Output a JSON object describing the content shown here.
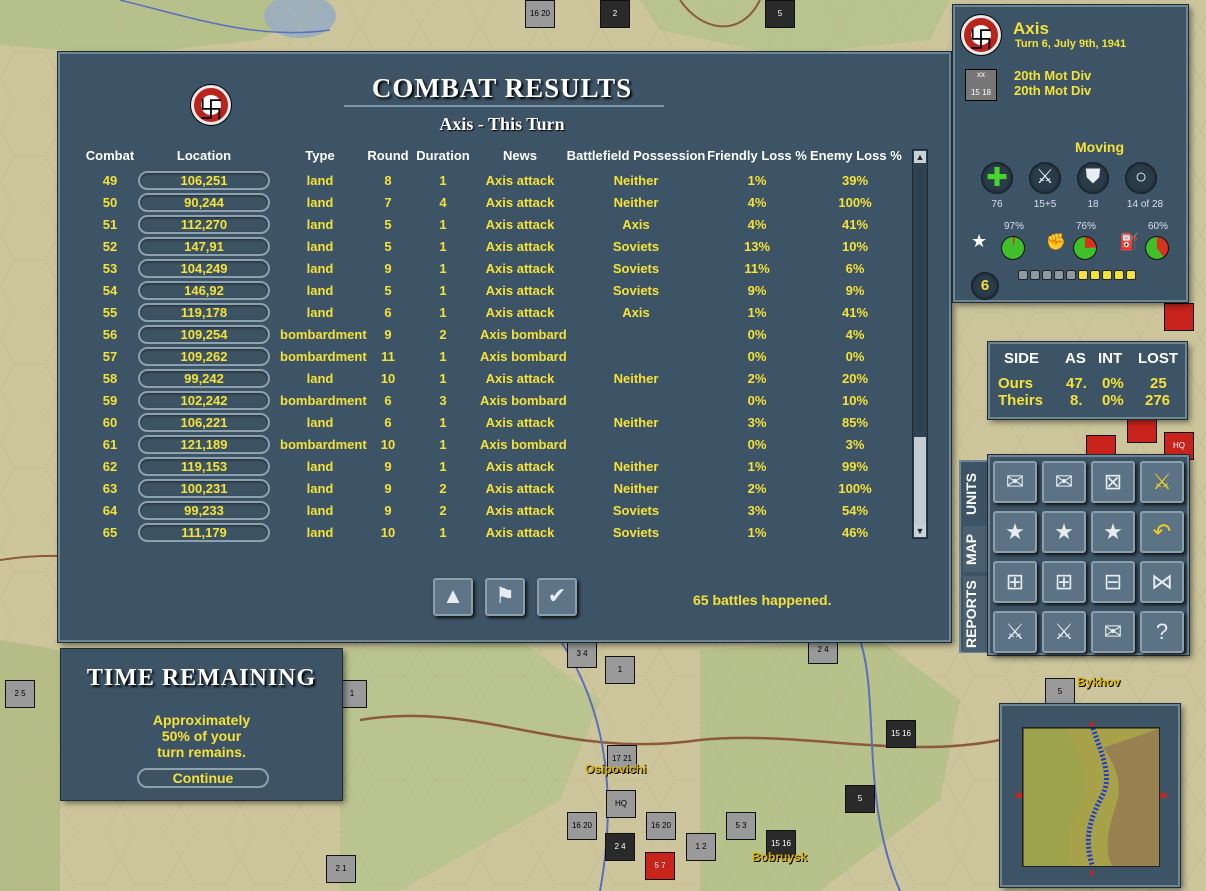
{
  "combat": {
    "title": "COMBAT RESULTS",
    "subtitle": "Axis - This Turn",
    "headers": {
      "combat": "Combat",
      "location": "Location",
      "type": "Type",
      "round": "Round",
      "duration": "Duration",
      "news": "News",
      "possession": "Battlefield Possession",
      "friendly": "Friendly Loss %",
      "enemy": "Enemy Loss %"
    },
    "rows": [
      {
        "combat": "49",
        "location": "106,251",
        "type": "land",
        "round": "8",
        "duration": "1",
        "news": "Axis attack",
        "possession": "Neither",
        "friendly": "1%",
        "enemy": "39%"
      },
      {
        "combat": "50",
        "location": "90,244",
        "type": "land",
        "round": "7",
        "duration": "4",
        "news": "Axis attack",
        "possession": "Neither",
        "friendly": "4%",
        "enemy": "100%"
      },
      {
        "combat": "51",
        "location": "112,270",
        "type": "land",
        "round": "5",
        "duration": "1",
        "news": "Axis attack",
        "possession": "Axis",
        "friendly": "4%",
        "enemy": "41%"
      },
      {
        "combat": "52",
        "location": "147,91",
        "type": "land",
        "round": "5",
        "duration": "1",
        "news": "Axis attack",
        "possession": "Soviets",
        "friendly": "13%",
        "enemy": "10%"
      },
      {
        "combat": "53",
        "location": "104,249",
        "type": "land",
        "round": "9",
        "duration": "1",
        "news": "Axis attack",
        "possession": "Soviets",
        "friendly": "11%",
        "enemy": "6%"
      },
      {
        "combat": "54",
        "location": "146,92",
        "type": "land",
        "round": "5",
        "duration": "1",
        "news": "Axis attack",
        "possession": "Soviets",
        "friendly": "9%",
        "enemy": "9%"
      },
      {
        "combat": "55",
        "location": "119,178",
        "type": "land",
        "round": "6",
        "duration": "1",
        "news": "Axis attack",
        "possession": "Axis",
        "friendly": "1%",
        "enemy": "41%"
      },
      {
        "combat": "56",
        "location": "109,254",
        "type": "bombardment",
        "round": "9",
        "duration": "2",
        "news": "Axis bombard",
        "possession": "",
        "friendly": "0%",
        "enemy": "4%"
      },
      {
        "combat": "57",
        "location": "109,262",
        "type": "bombardment",
        "round": "11",
        "duration": "1",
        "news": "Axis bombard",
        "possession": "",
        "friendly": "0%",
        "enemy": "0%"
      },
      {
        "combat": "58",
        "location": "99,242",
        "type": "land",
        "round": "10",
        "duration": "1",
        "news": "Axis attack",
        "possession": "Neither",
        "friendly": "2%",
        "enemy": "20%"
      },
      {
        "combat": "59",
        "location": "102,242",
        "type": "bombardment",
        "round": "6",
        "duration": "3",
        "news": "Axis bombard",
        "possession": "",
        "friendly": "0%",
        "enemy": "10%"
      },
      {
        "combat": "60",
        "location": "106,221",
        "type": "land",
        "round": "6",
        "duration": "1",
        "news": "Axis attack",
        "possession": "Neither",
        "friendly": "3%",
        "enemy": "85%"
      },
      {
        "combat": "61",
        "location": "121,189",
        "type": "bombardment",
        "round": "10",
        "duration": "1",
        "news": "Axis bombard",
        "possession": "",
        "friendly": "0%",
        "enemy": "3%"
      },
      {
        "combat": "62",
        "location": "119,153",
        "type": "land",
        "round": "9",
        "duration": "1",
        "news": "Axis attack",
        "possession": "Neither",
        "friendly": "1%",
        "enemy": "99%"
      },
      {
        "combat": "63",
        "location": "100,231",
        "type": "land",
        "round": "9",
        "duration": "2",
        "news": "Axis attack",
        "possession": "Neither",
        "friendly": "2%",
        "enemy": "100%"
      },
      {
        "combat": "64",
        "location": "99,233",
        "type": "land",
        "round": "9",
        "duration": "2",
        "news": "Axis attack",
        "possession": "Soviets",
        "friendly": "3%",
        "enemy": "54%"
      },
      {
        "combat": "65",
        "location": "111,179",
        "type": "land",
        "round": "10",
        "duration": "1",
        "news": "Axis attack",
        "possession": "Soviets",
        "friendly": "1%",
        "enemy": "46%"
      }
    ],
    "battles_text": "65 battles happened.",
    "buttons": {
      "up_icon": "triangle-up-icon",
      "flag_icon": "flag-icon",
      "ok_icon": "checkmark-icon"
    }
  },
  "time_remaining": {
    "title": "TIME REMAINING",
    "line1": "Approximately",
    "line2": "50% of your",
    "line3": "turn remains.",
    "continue": "Continue"
  },
  "info": {
    "side": "Axis",
    "date": "Turn 6, July 9th, 1941",
    "unit_line1": "20th Mot Div",
    "unit_line2": "20th Mot Div",
    "unit_counter_top": "xx",
    "unit_counter_bottom": "15 18",
    "status": "Moving",
    "stat_values": [
      "76",
      "15+5",
      "18",
      "14 of 28"
    ],
    "percents": [
      "97%",
      "76%",
      "60%"
    ],
    "pie_values": [
      97,
      76,
      60
    ],
    "level": "6",
    "bars_filled": 5,
    "bars_total": 10
  },
  "stats": {
    "headers": [
      "SIDE",
      "AS",
      "INT",
      "LOST"
    ],
    "ours": [
      "Ours",
      "47.",
      "0%",
      "25"
    ],
    "theirs": [
      "Theirs",
      "8.",
      "0%",
      "276"
    ]
  },
  "tabs": [
    "UNITS",
    "MAP",
    "REPORTS"
  ],
  "map_labels": [
    "Osipovichi",
    "Bykhov",
    "Bobruysk"
  ],
  "colors": {
    "panel": "#3d5466",
    "yellow": "#f4e23a",
    "axis_red": "#b9251c"
  }
}
